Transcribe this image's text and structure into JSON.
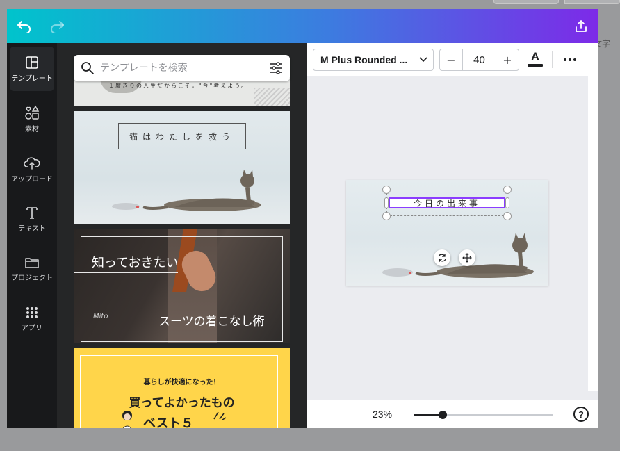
{
  "background": {
    "peek_text": "文字"
  },
  "toolbar_top": {
    "undo_icon": "undo-icon",
    "redo_icon": "redo-icon",
    "share_icon": "share-upload-icon"
  },
  "sidebar": {
    "items": [
      {
        "label": "テンプレート",
        "icon": "template-icon",
        "active": true
      },
      {
        "label": "素材",
        "icon": "elements-icon",
        "active": false
      },
      {
        "label": "アップロード",
        "icon": "cloud-upload-icon",
        "active": false
      },
      {
        "label": "テキスト",
        "icon": "text-icon",
        "active": false
      },
      {
        "label": "プロジェクト",
        "icon": "folder-icon",
        "active": false
      },
      {
        "label": "アプリ",
        "icon": "apps-grid-icon",
        "active": false
      }
    ]
  },
  "panel": {
    "search_placeholder": "テンプレートを検索",
    "templates": [
      {
        "text": "１度きりの人生だからこそ。\"今\"考えよう。"
      },
      {
        "text": "猫はわたしを救う"
      },
      {
        "text_top": "知っておきたい",
        "text_bottom": "スーツの着こなし術",
        "signature": "Mito"
      },
      {
        "text_top": "暮らしが快適になった！",
        "text_main": "買ってよかったもの",
        "text_bottom": "ベスト５"
      }
    ]
  },
  "editor_toolbar": {
    "font_name": "M Plus Rounded ...",
    "font_size": "40",
    "decrease": "−",
    "increase": "+",
    "text_color_letter": "A",
    "more_icon": "more-icon"
  },
  "canvas": {
    "selected_text": "今日の出来事"
  },
  "bottom_bar": {
    "zoom": "23%",
    "zoom_level": 0.21,
    "help": "?"
  }
}
